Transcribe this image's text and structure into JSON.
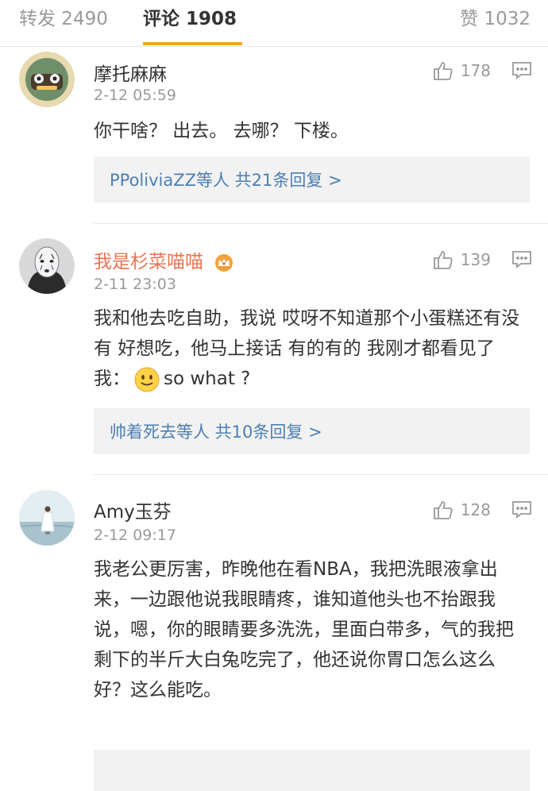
{
  "tabs": {
    "repost": "转发 2490",
    "comments": "评论 1908",
    "likes": "赞 1032"
  },
  "comments": [
    {
      "username": "摩托麻麻",
      "time": "2-12 05:59",
      "likes": "178",
      "text": "你干啥？  出去。 去哪？   下楼。",
      "replies": "PPoliviaZZ等人  共21条回复 >"
    },
    {
      "username": "我是杉菜喵喵",
      "time": "2-11 23:03",
      "likes": "139",
      "text": "我和他去吃自助，我说 哎呀不知道那个小蛋糕还有没有 好想吃，他马上接话 有的有的 我刚才都看见了  我：",
      "text_end": "so what ?",
      "replies": "帅着死去等人  共10条回复 >"
    },
    {
      "username": "Amy玉芬",
      "time": "2-12 09:17",
      "likes": "128",
      "text": "我老公更厉害，昨晚他在看NBA，我把洗眼液拿出来，一边跟他说我眼睛疼，谁知道他头也不抬跟我说，嗯，你的眼睛要多洗洗，里面白带多，气的我把剩下的半斤大白兔吃完了，他还说你胃口怎么这么好？这么能吃。"
    }
  ],
  "icons": {
    "like": "thumbs-up-icon",
    "reply": "comment-bubble-icon",
    "vip": "crown-icon",
    "emoji": "smile-emoji-icon"
  },
  "colors": {
    "accent": "#f5a623",
    "vip_name": "#eb7350",
    "link": "#4d7fb3",
    "muted": "#9a9a9a"
  }
}
